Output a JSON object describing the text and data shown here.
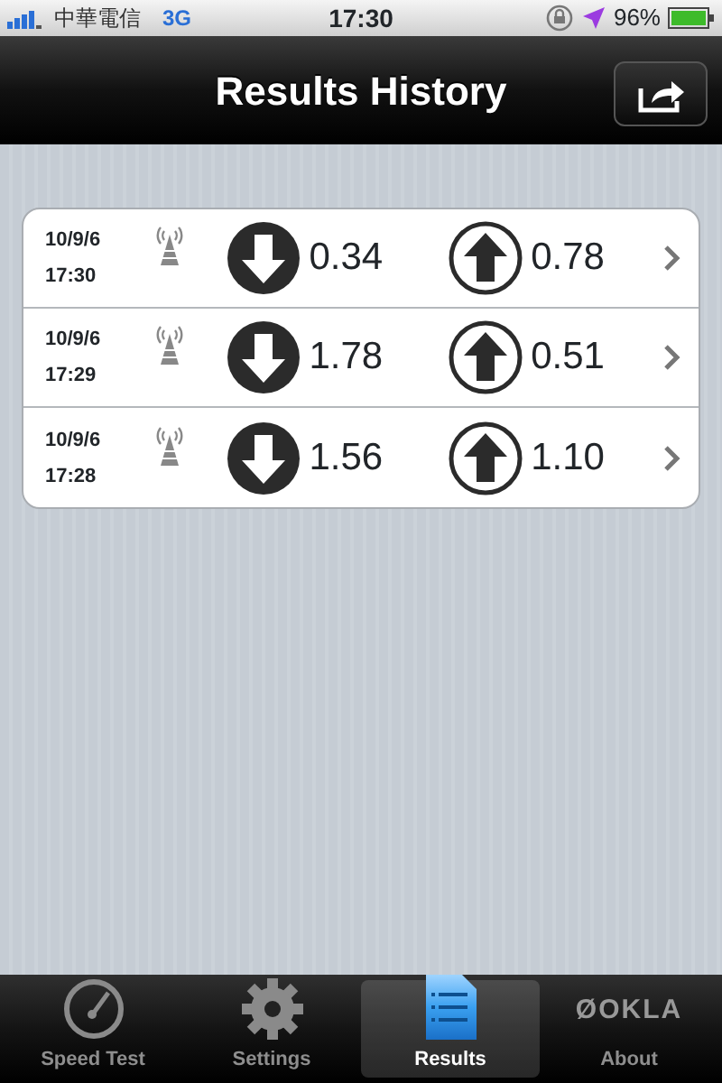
{
  "status_bar": {
    "carrier": "中華電信",
    "network": "3G",
    "time": "17:30",
    "battery": "96%"
  },
  "nav": {
    "title": "Results History"
  },
  "results": [
    {
      "date": "10/9/6",
      "time": "17:30",
      "download": "0.34",
      "upload": "0.78"
    },
    {
      "date": "10/9/6",
      "time": "17:29",
      "download": "1.78",
      "upload": "0.51"
    },
    {
      "date": "10/9/6",
      "time": "17:28",
      "download": "1.56",
      "upload": "1.10"
    }
  ],
  "tabs": [
    {
      "kind": "gauge",
      "label": "Speed Test",
      "selected": false
    },
    {
      "kind": "gear",
      "label": "Settings",
      "selected": false
    },
    {
      "kind": "document",
      "label": "Results",
      "selected": true
    },
    {
      "kind": "logo",
      "logo_text": "ØOKLA",
      "label": "About",
      "selected": false
    }
  ]
}
